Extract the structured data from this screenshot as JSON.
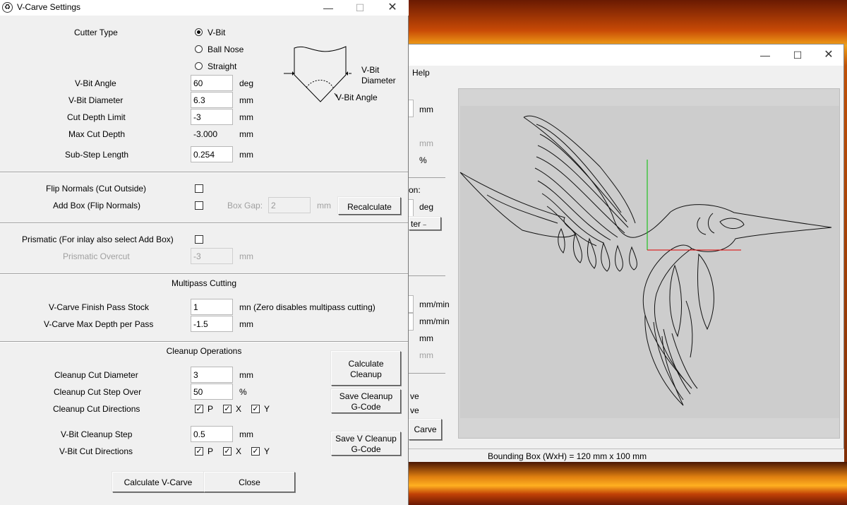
{
  "background_window": {
    "menu_help": "Help",
    "units": {
      "u1": "mm",
      "u2": "mm",
      "u3": "%",
      "u4": "deg",
      "u5": "mm/min",
      "u6": "mm/min",
      "u7": "mm",
      "u8": "mm"
    },
    "partial_label": "on:",
    "partial_dropdown": "ter",
    "partial_ve1": "ve",
    "partial_ve2": "ve",
    "partial_button": "Carve",
    "status_bar": "Bounding Box (WxH) = 120 mm  x 100 mm"
  },
  "dialog": {
    "title": "V-Carve Settings",
    "cutter_type_label": "Cutter Type",
    "cutter_options": {
      "vbit": "V-Bit",
      "ball": "Ball Nose",
      "straight": "Straight"
    },
    "diagram": {
      "diameter_line1": "V-Bit",
      "diameter_line2": "Diameter",
      "angle": "V-Bit Angle"
    },
    "vbit_angle": {
      "label": "V-Bit Angle",
      "value": "60",
      "unit": "deg"
    },
    "vbit_diameter": {
      "label": "V-Bit Diameter",
      "value": "6.3",
      "unit": "mm"
    },
    "cut_depth_limit": {
      "label": "Cut Depth Limit",
      "value": "-3",
      "unit": "mm"
    },
    "max_cut_depth": {
      "label": "Max Cut Depth",
      "value": "-3.000",
      "unit": "mm"
    },
    "sub_step_length": {
      "label": "Sub-Step Length",
      "value": "0.254",
      "unit": "mm"
    },
    "flip_normals_label": "Flip Normals (Cut Outside)",
    "add_box_label": "Add Box (Flip Normals)",
    "box_gap": {
      "label": "Box Gap:",
      "value": "2",
      "unit": "mm"
    },
    "recalculate": "Recalculate",
    "prismatic_label": "Prismatic (For inlay also select Add Box)",
    "prismatic_overcut": {
      "label": "Prismatic Overcut",
      "value": "-3",
      "unit": "mm"
    },
    "multipass_header": "Multipass Cutting",
    "finish_pass": {
      "label": "V-Carve Finish Pass Stock",
      "value": "1",
      "unit": "mn (Zero disables multipass cutting)"
    },
    "max_depth_pass": {
      "label": "V-Carve Max Depth per Pass",
      "value": "-1.5",
      "unit": "mm"
    },
    "cleanup_header": "Cleanup Operations",
    "cleanup_diameter": {
      "label": "Cleanup Cut Diameter",
      "value": "3",
      "unit": "mm"
    },
    "cleanup_stepover": {
      "label": "Cleanup Cut Step Over",
      "value": "50",
      "unit": "%"
    },
    "cleanup_directions_label": "Cleanup Cut Directions",
    "vbit_cleanup_step": {
      "label": "V-Bit Cleanup Step",
      "value": "0.5",
      "unit": "mm"
    },
    "vbit_directions_label": "V-Bit Cut Directions",
    "dir_labels": {
      "p": "P",
      "x": "X",
      "y": "Y"
    },
    "btn_calc_cleanup_1": "Calculate",
    "btn_calc_cleanup_2": "Cleanup",
    "btn_save_cleanup_1": "Save Cleanup",
    "btn_save_cleanup_2": "G-Code",
    "btn_save_v_cleanup_1": "Save V Cleanup",
    "btn_save_v_cleanup_2": "G-Code",
    "btn_calculate_vcarve": "Calculate V-Carve",
    "btn_close": "Close"
  }
}
